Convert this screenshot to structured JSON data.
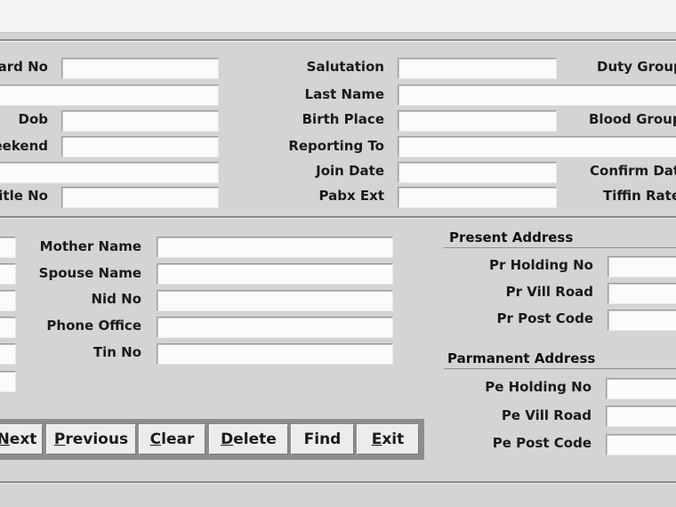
{
  "form": {
    "top": {
      "col1": {
        "card_no": "Card No",
        "dob": "Dob",
        "weekend": "eekend",
        "title_no": "itle No"
      },
      "col2": {
        "salutation": "Salutation",
        "last_name": "Last Name",
        "birth_place": "Birth Place",
        "reporting_to": "Reporting To",
        "join_date": "Join Date",
        "pabx_ext": "Pabx Ext"
      },
      "col3": {
        "duty_group": "Duty Group",
        "blood_group": "Blood Group",
        "confirm_date": "Confirm Date",
        "tiffin_rate": "Tiffin Rate"
      }
    },
    "personal": {
      "mother_name": "Mother Name",
      "spouse_name": "Spouse Name",
      "nid_no": "Nid No",
      "phone_office": "Phone Office",
      "tin_no": "Tin No"
    },
    "present_address": {
      "title": "Present Address",
      "holding_no": "Pr Holding No",
      "vill_road": "Pr Vill Road",
      "post_code": "Pr Post Code"
    },
    "permanent_address": {
      "title": "Parmanent Address",
      "holding_no": "Pe Holding No",
      "vill_road": "Pe Vill Road",
      "post_code": "Pe Post Code"
    },
    "buttons": {
      "next": {
        "mn": "N",
        "rest": "ext"
      },
      "previous": {
        "mn": "P",
        "rest": "revious"
      },
      "clear": {
        "mn": "C",
        "rest": "lear"
      },
      "delete": {
        "mn": "D",
        "rest": "elete"
      },
      "find": {
        "label": "Find"
      },
      "exit": {
        "mn": "E",
        "rest": "xit"
      }
    }
  }
}
